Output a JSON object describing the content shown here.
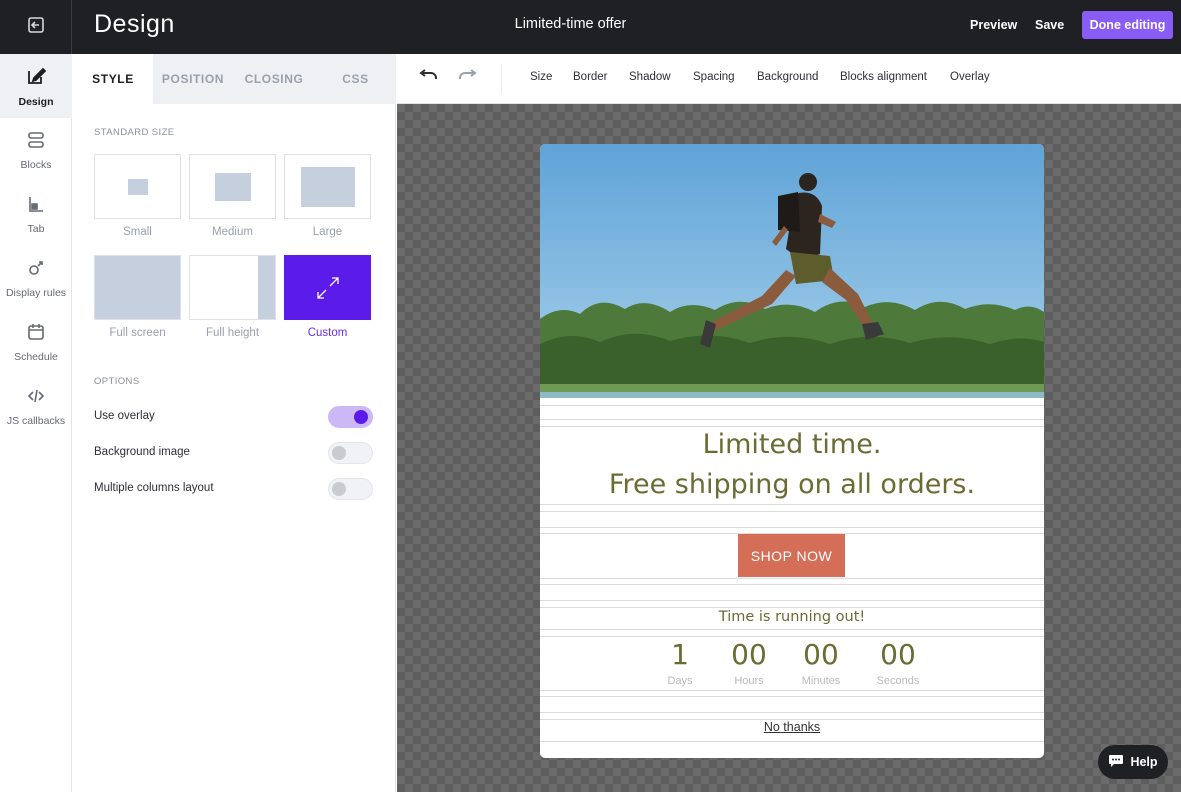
{
  "header": {
    "app_title": "Design",
    "document_title": "Limited-time offer",
    "preview_label": "Preview",
    "save_label": "Save",
    "done_label": "Done editing",
    "accent_color": "#8a5cf6"
  },
  "rail": {
    "items": [
      {
        "label": "Design",
        "icon": "design-pen-icon",
        "active": true
      },
      {
        "label": "Blocks",
        "icon": "blocks-icon"
      },
      {
        "label": "Tab",
        "icon": "tab-icon"
      },
      {
        "label": "Display rules",
        "icon": "display-rules-icon"
      },
      {
        "label": "Schedule",
        "icon": "calendar-icon"
      },
      {
        "label": "JS callbacks",
        "icon": "code-icon"
      }
    ]
  },
  "panel": {
    "tabs": [
      "STYLE",
      "POSITION",
      "CLOSING",
      "CSS"
    ],
    "active_tab": "STYLE",
    "standard_size_label": "STANDARD SIZE",
    "sizes": [
      "Small",
      "Medium",
      "Large",
      "Full screen",
      "Full height",
      "Custom"
    ],
    "selected_size": "Custom",
    "options_label": "OPTIONS",
    "options": [
      {
        "label": "Use overlay",
        "on": true
      },
      {
        "label": "Background image",
        "on": false
      },
      {
        "label": "Multiple columns layout",
        "on": false
      }
    ],
    "selected_color": "#5b1be8"
  },
  "toolbar": {
    "undo_icon": "undo-icon",
    "redo_icon": "redo-icon",
    "items": [
      "Size",
      "Border",
      "Shadow",
      "Spacing",
      "Background",
      "Blocks alignment",
      "Overlay"
    ]
  },
  "popup": {
    "headline_line1": "Limited time.",
    "headline_line2": "Free shipping on all orders.",
    "cta_label": "SHOP NOW",
    "cta_color": "#d46e57",
    "countdown_title": "Time is running out!",
    "countdown": [
      {
        "value": "1",
        "unit": "Days"
      },
      {
        "value": "00",
        "unit": "Hours"
      },
      {
        "value": "00",
        "unit": "Minutes"
      },
      {
        "value": "00",
        "unit": "Seconds"
      }
    ],
    "dismiss_label": "No thanks",
    "text_color": "#6b6b33"
  },
  "help": {
    "label": "Help"
  }
}
